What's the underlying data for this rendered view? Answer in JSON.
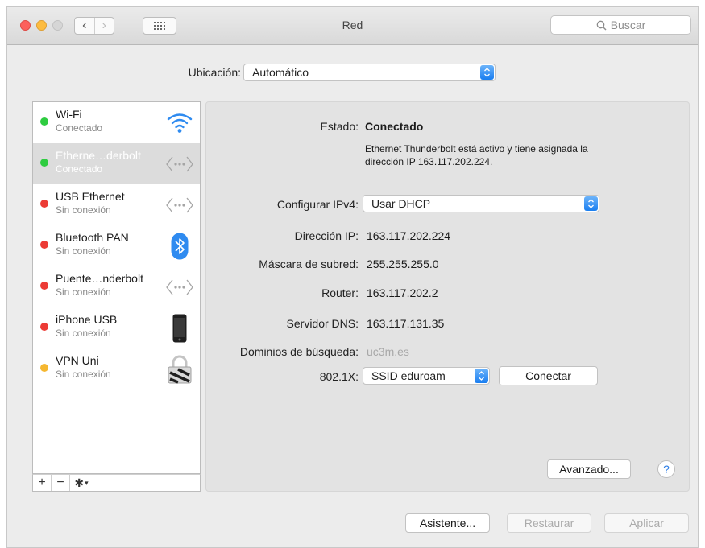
{
  "window": {
    "title": "Red"
  },
  "search": {
    "placeholder": "Buscar"
  },
  "location": {
    "label": "Ubicación:",
    "value": "Automático"
  },
  "services": [
    {
      "name": "Wi-Fi",
      "status": "Conectado",
      "status_color": "#2ecc40",
      "icon": "wifi-icon"
    },
    {
      "name": "Etherne…derbolt",
      "status": "Conectado",
      "status_color": "#2ecc40",
      "icon": "ethernet-icon",
      "selected": true
    },
    {
      "name": "USB Ethernet",
      "status": "Sin conexión",
      "status_color": "#ec3b35",
      "icon": "ethernet-icon"
    },
    {
      "name": "Bluetooth PAN",
      "status": "Sin conexión",
      "status_color": "#ec3b35",
      "icon": "bluetooth-icon"
    },
    {
      "name": "Puente…nderbolt",
      "status": "Sin conexión",
      "status_color": "#ec3b35",
      "icon": "ethernet-icon"
    },
    {
      "name": "iPhone USB",
      "status": "Sin conexión",
      "status_color": "#ec3b35",
      "icon": "iphone-icon"
    },
    {
      "name": "VPN Uni",
      "status": "Sin conexión",
      "status_color": "#f5b730",
      "icon": "vpn-lock-icon"
    }
  ],
  "tools": {
    "add": "+",
    "remove": "−"
  },
  "detail": {
    "status_label": "Estado:",
    "status_value": "Conectado",
    "status_desc_1": "Ethernet Thunderbolt está activo y tiene asignada la",
    "status_desc_2": "dirección IP 163.117.202.224.",
    "ipv4_label": "Configurar IPv4:",
    "ipv4_value": "Usar DHCP",
    "ip_label": "Dirección IP:",
    "ip_value": "163.117.202.224",
    "mask_label": "Máscara de subred:",
    "mask_value": "255.255.255.0",
    "router_label": "Router:",
    "router_value": "163.117.202.2",
    "dns_label": "Servidor DNS:",
    "dns_value": "163.117.131.35",
    "domains_label": "Dominios de búsqueda:",
    "domains_value": "uc3m.es",
    "x8021_label": "802.1X:",
    "x8021_value": "SSID eduroam",
    "connect_button": "Conectar",
    "advanced_button": "Avanzado...",
    "help_button": "?"
  },
  "footer": {
    "assistant_button": "Asistente...",
    "restore_button": "Restaurar",
    "apply_button": "Aplicar"
  },
  "colors": {
    "accent": "#1a7ef0",
    "green": "#2ecc40",
    "red": "#ec3b35",
    "amber": "#f5b730"
  }
}
